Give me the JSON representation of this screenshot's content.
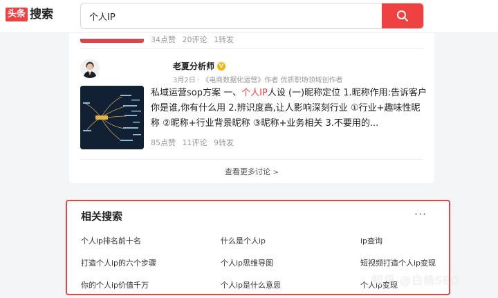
{
  "logo": {
    "badge": "头条",
    "text": "搜索"
  },
  "search": {
    "query": "个人IP"
  },
  "previous_post": {
    "likes": "34点赞",
    "comments": "20评论",
    "shares": "1转发"
  },
  "post": {
    "author_name": "老夏分析师",
    "verified_badge": "V",
    "author_sub": "3月2日 · 《电商数据化运营》作者 优质职场领域创作者",
    "content_before": "私域运营sop方案 一、",
    "content_highlight": "个人IP",
    "content_after": "人设 (一)昵称定位 1.昵称作用:告诉客户你是谁,你有什么用 2.辨识度高,让人影响深刻行业 ①行业+趣味性昵称 ②昵称+行业背景昵称 ③昵称+业务相关 3.不要用的...",
    "likes": "85点赞",
    "comments": "11评论",
    "shares": "9转发"
  },
  "more_discussions": {
    "label": "查看更多讨论",
    "chevron": ">"
  },
  "related": {
    "title": "相关搜索",
    "more_glyph": "···",
    "items": [
      "个人ip排名前十名",
      "什么是个人ip",
      "ip查询",
      "打造个人ip的六个步骤",
      "个人ip思维导图",
      "短视频打造个人ip变现",
      "你的个人ip价值千万",
      "个人ip是什么意思",
      "个人ip变现"
    ]
  },
  "watermark": "知乎 @白杨SEO",
  "colors": {
    "brand_red": "#f04142",
    "highlight_border": "#e2454a",
    "verified": "#f7b500"
  },
  "icons": {
    "search_button": "search-icon",
    "verified": "verified-badge-icon",
    "more": "more-dots-icon"
  }
}
